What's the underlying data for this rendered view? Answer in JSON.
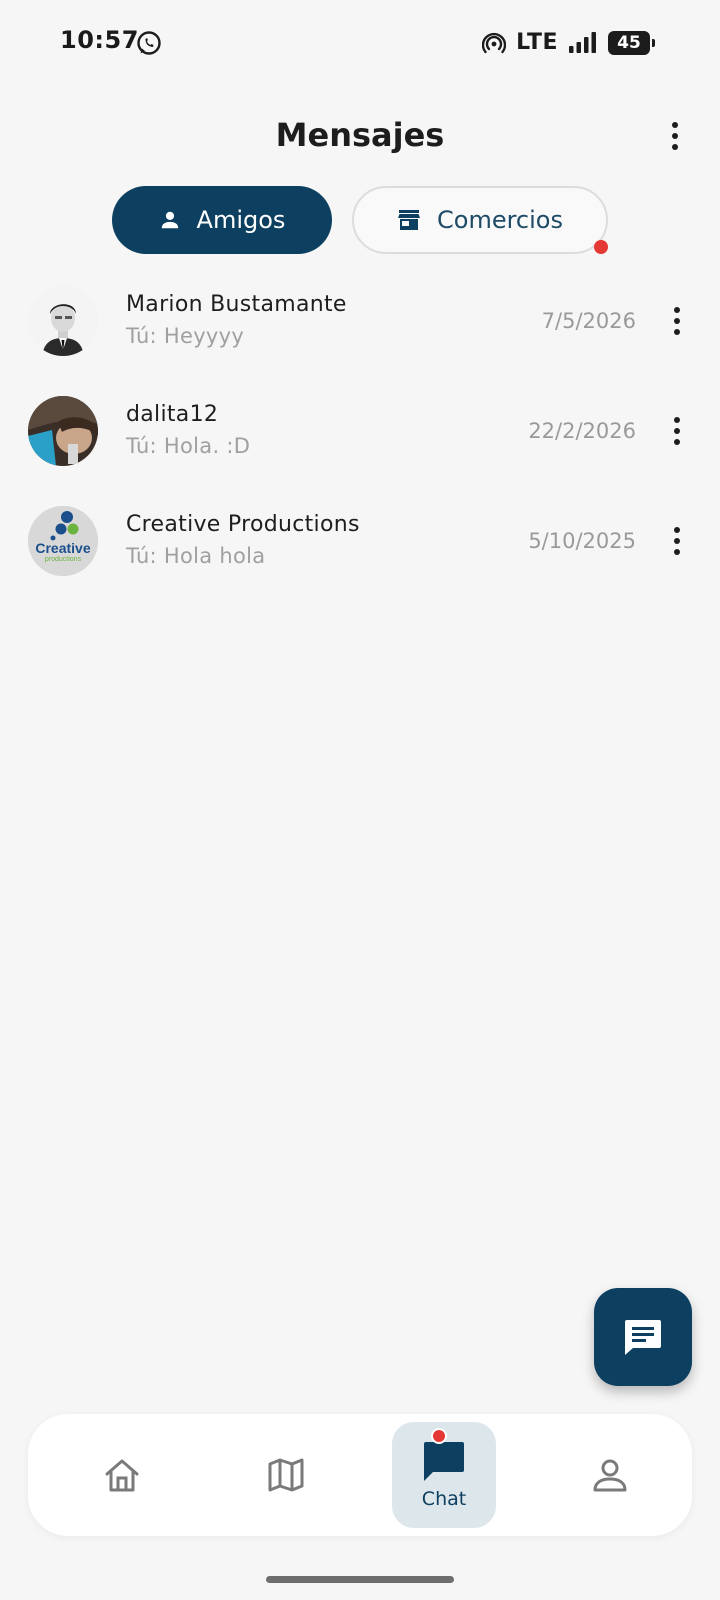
{
  "status_bar": {
    "time": "10:57",
    "network": "LTE",
    "battery": "45"
  },
  "header": {
    "title": "Mensajes"
  },
  "tabs": [
    {
      "label": "Amigos",
      "icon": "person-icon",
      "active": true
    },
    {
      "label": "Comercios",
      "icon": "store-icon",
      "active": false,
      "has_badge": true
    }
  ],
  "chats": [
    {
      "name": "Marion Bustamante",
      "preview": "Tú: Heyyyy",
      "date": "7/5/2026",
      "avatar": "photo-portrait"
    },
    {
      "name": "dalita12",
      "preview": "Tú: Hola. :D",
      "date": "22/2/2026",
      "avatar": "photo-selfie"
    },
    {
      "name": "Creative Productions",
      "preview": "Tú: Hola hola",
      "date": "5/10/2025",
      "avatar": "creative-logo",
      "logo_text": "Creative",
      "logo_subtext": "productions"
    }
  ],
  "bottom_nav": {
    "items": [
      {
        "icon": "home-icon",
        "label": ""
      },
      {
        "icon": "map-icon",
        "label": ""
      },
      {
        "icon": "chat-icon",
        "label": "Chat",
        "active": true,
        "has_badge": true
      },
      {
        "icon": "profile-icon",
        "label": ""
      }
    ]
  },
  "colors": {
    "primary": "#0d4060",
    "badge": "#e53935",
    "background": "#f6f6f6"
  }
}
